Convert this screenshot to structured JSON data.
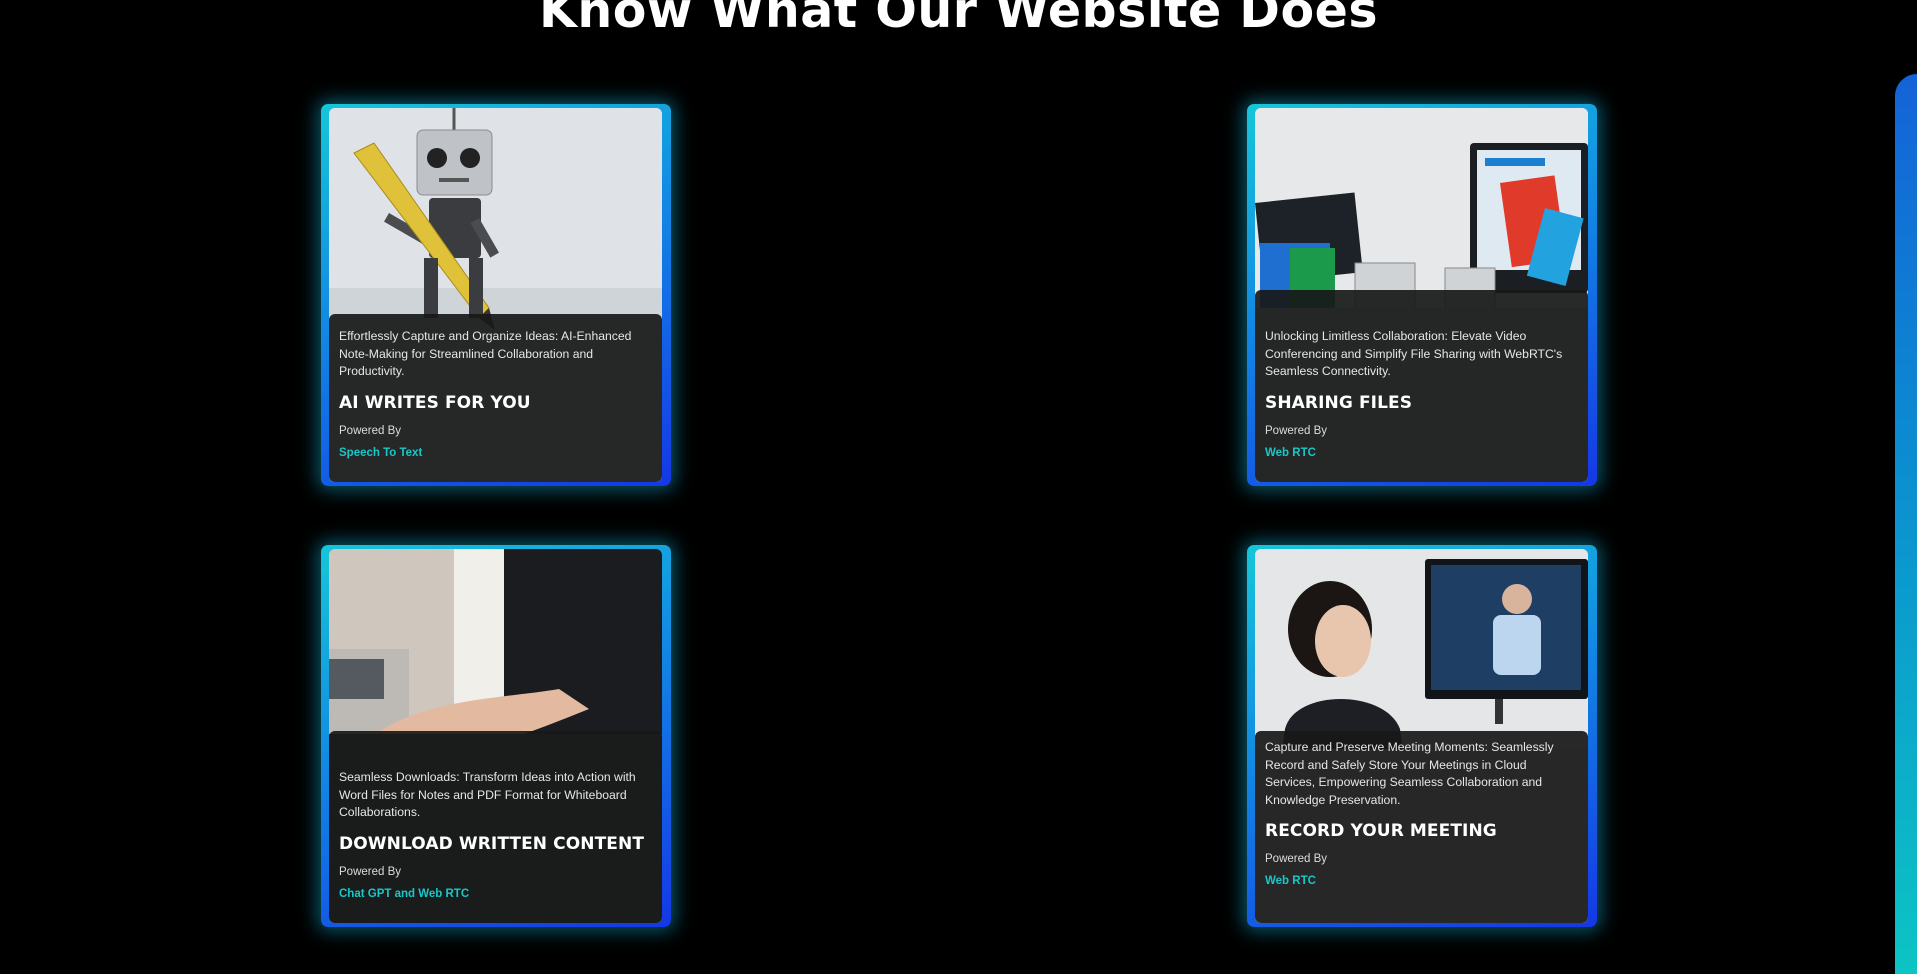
{
  "section": {
    "title": "Know What Our Website Does"
  },
  "cards": [
    {
      "image": "robot-writing-with-pencil-photo",
      "description": "Effortlessly Capture and Organize Ideas: AI-Enhanced Note-Making for Streamlined Collaboration and Productivity.",
      "title": "AI WRITES FOR YOU",
      "powered_label": "Powered By",
      "tech": "Speech To Text"
    },
    {
      "image": "desk-with-monitors-and-files-photo",
      "description": "Unlocking Limitless Collaboration: Elevate Video Conferencing and Simplify File Sharing with WebRTC's Seamless Connectivity.",
      "title": "SHARING FILES",
      "powered_label": "Powered By",
      "tech": "Web RTC"
    },
    {
      "image": "hand-on-laptop-keyboard-photo",
      "description": "Seamless Downloads: Transform Ideas into Action with Word Files for Notes and PDF Format for Whiteboard Collaborations.",
      "title": "DOWNLOAD WRITTEN CONTENT",
      "powered_label": "Powered By",
      "tech": "Chat GPT and Web RTC"
    },
    {
      "image": "woman-in-video-meeting-photo",
      "description": "Capture and Preserve Meeting Moments: Seamlessly Record and Safely Store Your Meetings in Cloud Services, Empowering Seamless Collaboration and Knowledge Preservation.",
      "title": "RECORD YOUR MEETING",
      "powered_label": "Powered By",
      "tech": "Web RTC"
    }
  ],
  "colors": {
    "background": "#000000",
    "accent_link": "#18c8c8",
    "card_border_start": "#16c6d9",
    "card_border_end": "#1437e6"
  }
}
